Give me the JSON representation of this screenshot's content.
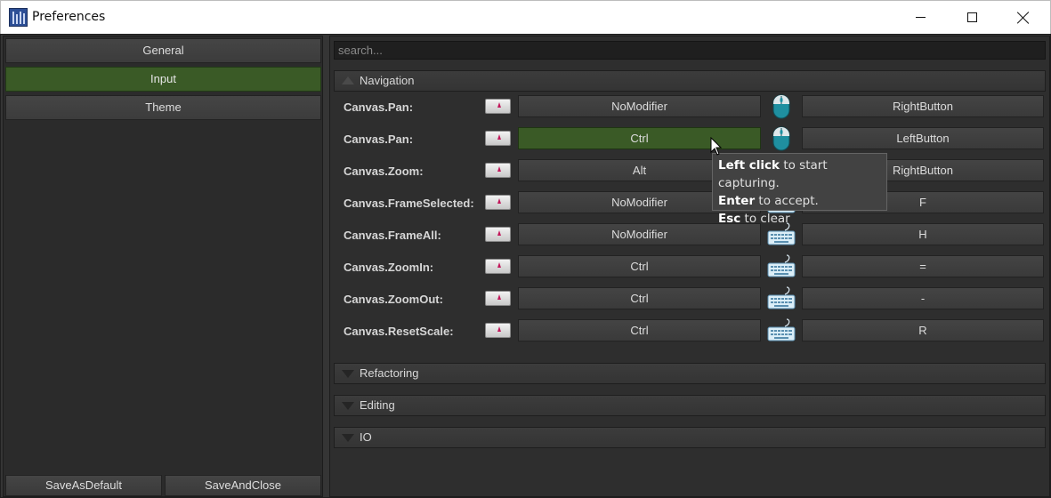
{
  "window": {
    "title": "Preferences"
  },
  "sidebar": {
    "items": [
      {
        "label": "General",
        "active": false
      },
      {
        "label": "Input",
        "active": true
      },
      {
        "label": "Theme",
        "active": false
      }
    ],
    "save_default_label": "SaveAsDefault",
    "save_close_label": "SaveAndClose"
  },
  "search": {
    "placeholder": "search..."
  },
  "sections": {
    "navigation": "Navigation",
    "refactoring": "Refactoring",
    "editing": "Editing",
    "io": "IO"
  },
  "bindings": [
    {
      "action": "Canvas.Pan:",
      "modifier": "NoModifier",
      "device": "mouse-icon",
      "key": "RightButton"
    },
    {
      "action": "Canvas.Pan:",
      "modifier": "Ctrl",
      "device": "mouse-icon",
      "key": "LeftButton",
      "active": true
    },
    {
      "action": "Canvas.Zoom:",
      "modifier": "Alt",
      "device": "mouse-icon",
      "key": "RightButton"
    },
    {
      "action": "Canvas.FrameSelected:",
      "modifier": "NoModifier",
      "device": "keyboard-icon",
      "key": "F"
    },
    {
      "action": "Canvas.FrameAll:",
      "modifier": "NoModifier",
      "device": "keyboard-icon",
      "key": "H"
    },
    {
      "action": "Canvas.ZoomIn:",
      "modifier": "Ctrl",
      "device": "keyboard-icon",
      "key": "="
    },
    {
      "action": "Canvas.ZoomOut:",
      "modifier": "Ctrl",
      "device": "keyboard-icon",
      "key": "-"
    },
    {
      "action": "Canvas.ResetScale:",
      "modifier": "Ctrl",
      "device": "keyboard-icon",
      "key": "R"
    }
  ],
  "tooltip": {
    "line1_bold": "Left click",
    "line1_rest": " to start capturing.",
    "line2_bold": "Enter",
    "line2_rest": " to accept.",
    "line3_bold": "Esc",
    "line3_rest": " to clear"
  },
  "colors": {
    "accent_green": "#3a5a26",
    "mouse_teal": "#1f8fa0"
  }
}
